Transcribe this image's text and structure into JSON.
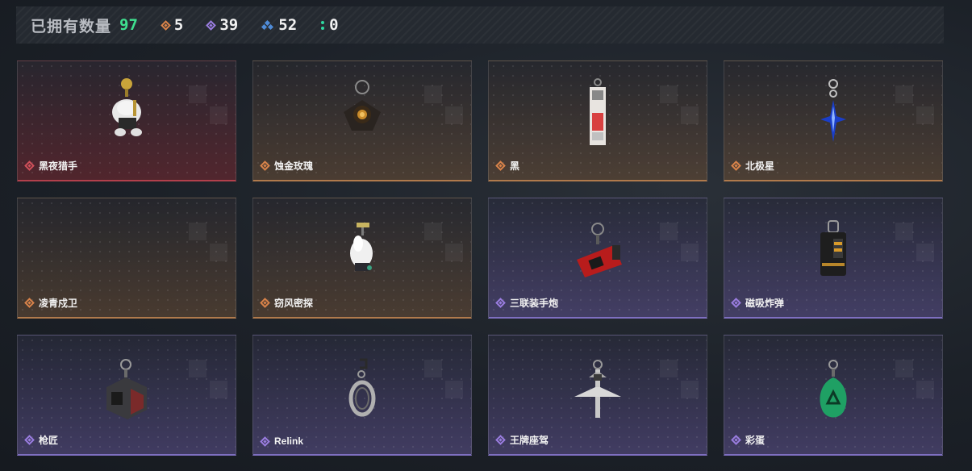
{
  "header": {
    "title": "已拥有数量",
    "total": "97",
    "counts": [
      {
        "icon": "orange-diamond-icon",
        "value": "5",
        "color": "#d9834a"
      },
      {
        "icon": "purple-diamond-icon",
        "value": "39",
        "color": "#9a7de0"
      },
      {
        "icon": "blue-triangle-icon",
        "value": "52",
        "color": "#4f8cd8"
      },
      {
        "icon": "green-dots-icon",
        "value": "0",
        "color": "#2fd8a0"
      }
    ]
  },
  "items": [
    {
      "name": "黑夜猎手",
      "rarity": "red",
      "icon": "gold-cat-figure-charm"
    },
    {
      "name": "蚀金玫瑰",
      "rarity": "orange",
      "icon": "rose-charm"
    },
    {
      "name": "黑",
      "rarity": "orange",
      "icon": "card-charm"
    },
    {
      "name": "北极星",
      "rarity": "orange",
      "icon": "star-charm"
    },
    {
      "name": "凌青戍卫",
      "rarity": "orange",
      "icon": "empty"
    },
    {
      "name": "窃风密探",
      "rarity": "orange",
      "icon": "white-hooded-figure-charm"
    },
    {
      "name": "三联装手炮",
      "rarity": "purple",
      "icon": "cannon-charm"
    },
    {
      "name": "磁吸炸弹",
      "rarity": "purple",
      "icon": "bomb-charm"
    },
    {
      "name": "枪匠",
      "rarity": "purple",
      "icon": "gunsmith-box-charm"
    },
    {
      "name": "Relink",
      "rarity": "purple",
      "icon": "relink-ring-charm"
    },
    {
      "name": "王牌座驾",
      "rarity": "purple",
      "icon": "jet-charm"
    },
    {
      "name": "彩蛋",
      "rarity": "purple",
      "icon": "green-egg-charm"
    }
  ]
}
